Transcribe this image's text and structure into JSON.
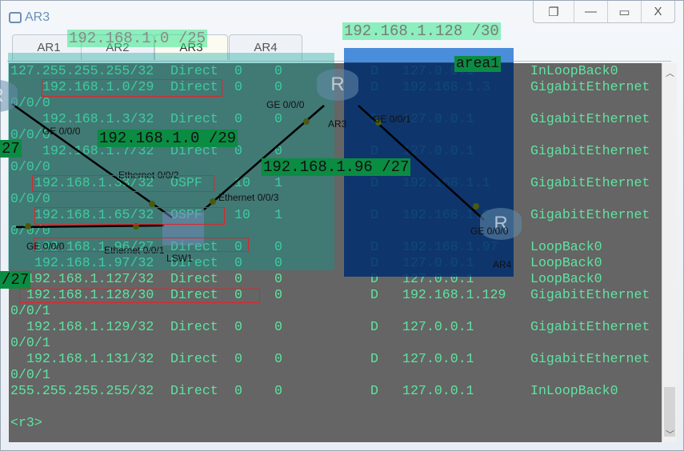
{
  "window": {
    "title": "AR3",
    "controls": [
      "restore",
      "minimize",
      "maximize",
      "close"
    ],
    "close_label": "X"
  },
  "tabs": [
    {
      "label": "AR1"
    },
    {
      "label": "AR2"
    },
    {
      "label": "AR3",
      "active": true
    },
    {
      "label": "AR4"
    }
  ],
  "routes": [
    {
      "dest": "127.255.255.255/32",
      "proto": "Direct",
      "pre": "0",
      "cost": "0",
      "flags": "D",
      "nexthop": "127.0.0.1",
      "iface": "InLoopBack0",
      "cont": ""
    },
    {
      "dest": "192.168.1.0/29",
      "proto": "Direct",
      "pre": "0",
      "cost": "0",
      "flags": "D",
      "nexthop": "192.168.1.3",
      "iface": "GigabitEthernet",
      "cont": "0/0/0"
    },
    {
      "dest": "192.168.1.3/32",
      "proto": "Direct",
      "pre": "0",
      "cost": "0",
      "flags": "D",
      "nexthop": "127.0.0.1",
      "iface": "GigabitEthernet",
      "cont": "0/0/0"
    },
    {
      "dest": "192.168.1.7/32",
      "proto": "Direct",
      "pre": "0",
      "cost": "0",
      "flags": "D",
      "nexthop": "127.0.0.1",
      "iface": "GigabitEthernet",
      "cont": "0/0/0"
    },
    {
      "dest": "192.168.1.33/32",
      "proto": "OSPF",
      "pre": "10",
      "cost": "1",
      "flags": "D",
      "nexthop": "192.168.1.1",
      "iface": "GigabitEthernet",
      "cont": "0/0/0"
    },
    {
      "dest": "192.168.1.65/32",
      "proto": "OSPF",
      "pre": "10",
      "cost": "1",
      "flags": "D",
      "nexthop": "192.168.1.2",
      "iface": "GigabitEthernet",
      "cont": "0/0/0"
    },
    {
      "dest": "192.168.1.96/27",
      "proto": "Direct",
      "pre": "0",
      "cost": "0",
      "flags": "D",
      "nexthop": "192.168.1.97",
      "iface": "LoopBack0",
      "cont": ""
    },
    {
      "dest": "192.168.1.97/32",
      "proto": "Direct",
      "pre": "0",
      "cost": "0",
      "flags": "D",
      "nexthop": "127.0.0.1",
      "iface": "LoopBack0",
      "cont": ""
    },
    {
      "dest": "192.168.1.127/32",
      "proto": "Direct",
      "pre": "0",
      "cost": "0",
      "flags": "D",
      "nexthop": "127.0.0.1",
      "iface": "LoopBack0",
      "cont": ""
    },
    {
      "dest": "192.168.1.128/30",
      "proto": "Direct",
      "pre": "0",
      "cost": "0",
      "flags": "D",
      "nexthop": "192.168.1.129",
      "iface": "GigabitEthernet",
      "cont": "0/0/1"
    },
    {
      "dest": "192.168.1.129/32",
      "proto": "Direct",
      "pre": "0",
      "cost": "0",
      "flags": "D",
      "nexthop": "127.0.0.1",
      "iface": "GigabitEthernet",
      "cont": "0/0/1"
    },
    {
      "dest": "192.168.1.131/32",
      "proto": "Direct",
      "pre": "0",
      "cost": "0",
      "flags": "D",
      "nexthop": "127.0.0.1",
      "iface": "GigabitEthernet",
      "cont": "0/0/1"
    },
    {
      "dest": "255.255.255.255/32",
      "proto": "Direct",
      "pre": "0",
      "cost": "0",
      "flags": "D",
      "nexthop": "127.0.0.1",
      "iface": "InLoopBack0",
      "cont": ""
    }
  ],
  "prompt": "<r3>",
  "overlay": {
    "subnet_labels": [
      "192.168.1.0 /25",
      "192.168.1.128 /30",
      "192.168.1.0 /29",
      "192.168.1.96 /27",
      "27",
      "/27"
    ],
    "area_label": "area1",
    "devices": [
      "AR3",
      "AR4",
      "LSW1"
    ],
    "ports": [
      "GE 0/0/0",
      "GE 0/0/1",
      "GE 0/0/0",
      "GE 0/0/0",
      "Ethernet 0/0/2",
      "Ethernet 0/0/3",
      "Ethernet 0/0/1",
      "GE 0/0/0"
    ],
    "colors": {
      "subnet_label_bg": "#19c864",
      "area_bg": "#003366",
      "highlight_box": "#e0242a"
    }
  }
}
